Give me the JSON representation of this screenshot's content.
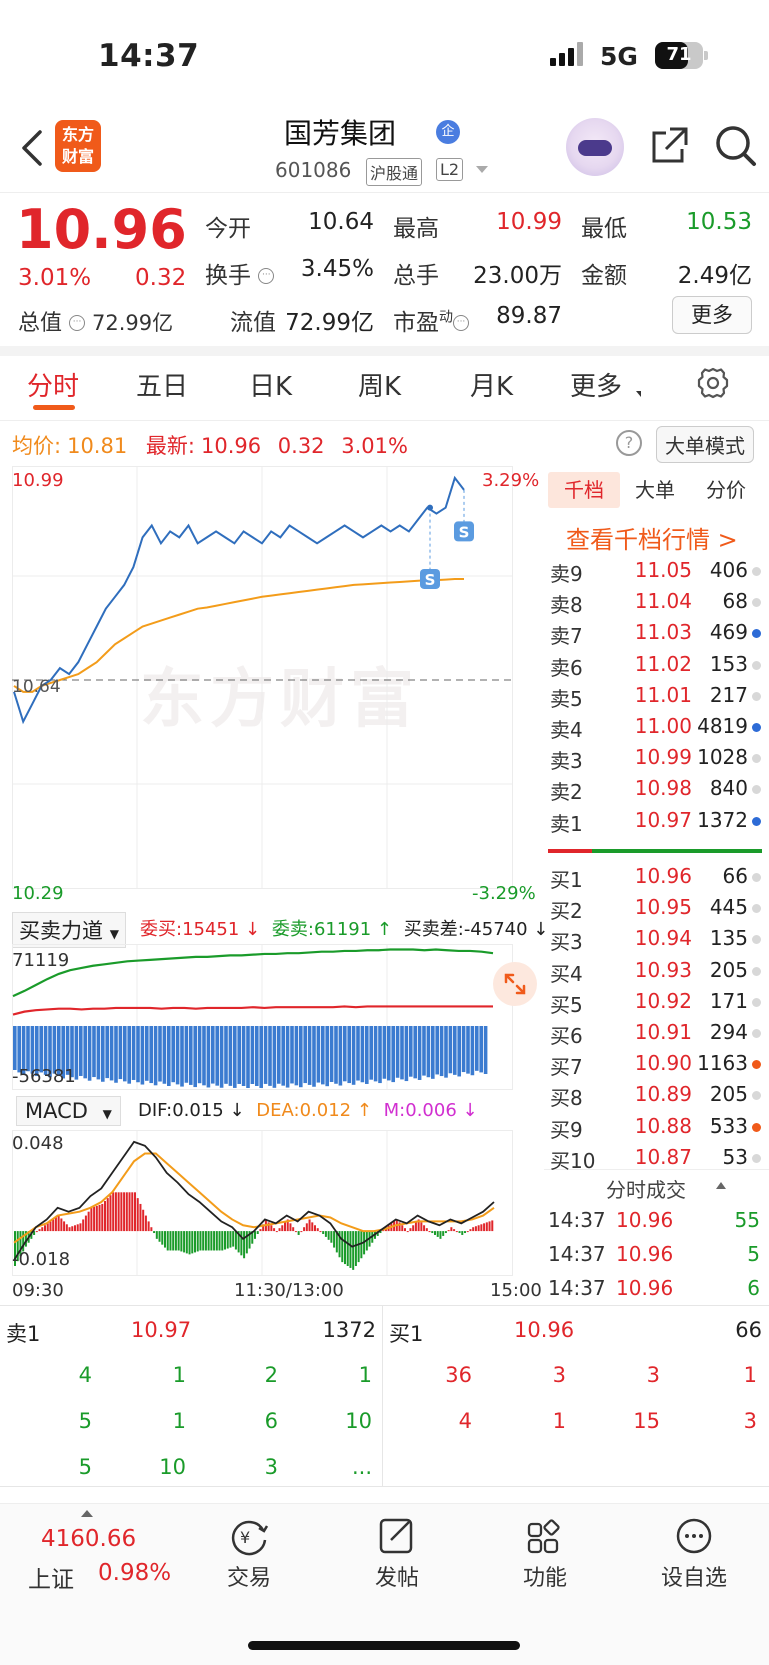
{
  "status_bar": {
    "time": "14:37",
    "network": "5G",
    "battery": "71"
  },
  "header": {
    "logo_text": "东方财富",
    "title": "国芳集团",
    "title_badge": "企",
    "code": "601086",
    "tag_hgt": "沪股通",
    "tag_l2": "L2"
  },
  "quote": {
    "price": "10.96",
    "change_pct": "3.01%",
    "change": "0.32",
    "stats": [
      {
        "label": "今开",
        "value": "10.64",
        "color": "#222222"
      },
      {
        "label": "最高",
        "value": "10.99",
        "color": "#e0262b"
      },
      {
        "label": "最低",
        "value": "10.53",
        "color": "#1a9b2a"
      },
      {
        "label": "换手",
        "value": "3.45%",
        "color": "#222222"
      },
      {
        "label": "总手",
        "value": "23.00万",
        "color": "#222222"
      },
      {
        "label": "金额",
        "value": "2.49亿",
        "color": "#222222"
      },
      {
        "label": "流值",
        "value": "72.99亿",
        "color": "#222222"
      },
      {
        "label": "市盈",
        "value": "89.87",
        "color": "#222222"
      }
    ],
    "total_value_label": "总值",
    "total_value": "72.99亿",
    "pe_sup": "动",
    "more": "更多"
  },
  "tabs": [
    "分时",
    "五日",
    "日K",
    "周K",
    "月K",
    "更多"
  ],
  "info_line": {
    "avg_label": "均价:",
    "avg": "10.81",
    "latest_label": "最新:",
    "latest": "10.96",
    "chg": "0.32",
    "pct": "3.01%",
    "help": "?",
    "bigmode": "大单模式"
  },
  "chart": {
    "high": "10.99",
    "low": "10.29",
    "high_pct": "3.29%",
    "low_pct": "-3.29%",
    "open": "10.64",
    "watermark": "东方财富",
    "marker": "S",
    "ylim": [
      10.29,
      10.99
    ],
    "price_series": [
      10.62,
      10.57,
      10.6,
      10.63,
      10.64,
      10.66,
      10.65,
      10.67,
      10.7,
      10.73,
      10.76,
      10.78,
      10.8,
      10.83,
      10.88,
      10.9,
      10.87,
      10.89,
      10.88,
      10.9,
      10.87,
      10.88,
      10.89,
      10.88,
      10.87,
      10.89,
      10.88,
      10.87,
      10.89,
      10.88,
      10.9,
      10.89,
      10.88,
      10.87,
      10.88,
      10.89,
      10.9,
      10.89,
      10.88,
      10.89,
      10.9,
      10.89,
      10.9,
      10.89,
      10.91,
      10.93,
      10.92,
      10.93,
      10.98,
      10.96
    ],
    "avg_series": [
      10.63,
      10.62,
      10.62,
      10.63,
      10.635,
      10.64,
      10.645,
      10.65,
      10.66,
      10.67,
      10.685,
      10.7,
      10.71,
      10.72,
      10.73,
      10.735,
      10.74,
      10.745,
      10.75,
      10.755,
      10.76,
      10.762,
      10.765,
      10.768,
      10.771,
      10.774,
      10.777,
      10.78,
      10.782,
      10.784,
      10.786,
      10.788,
      10.79,
      10.792,
      10.794,
      10.796,
      10.798,
      10.8,
      10.801,
      10.802,
      10.803,
      10.804,
      10.805,
      10.806,
      10.807,
      10.808,
      10.808,
      10.809,
      10.81,
      10.81
    ]
  },
  "moneyflow": {
    "selector": "买卖力道",
    "wb_label": "委买:15451",
    "ws_label": "委卖:61191",
    "diff_label": "买卖差:-45740",
    "top": "71119",
    "bottom": "-56381",
    "green_series": [
      0.35,
      0.42,
      0.5,
      0.58,
      0.65,
      0.7,
      0.73,
      0.76,
      0.78,
      0.8,
      0.82,
      0.83,
      0.84,
      0.85,
      0.86,
      0.87,
      0.88,
      0.88,
      0.89,
      0.9,
      0.9,
      0.91,
      0.92,
      0.92,
      0.93,
      0.93,
      0.94,
      0.95,
      0.95,
      0.96,
      0.96,
      0.97,
      0.97,
      0.98,
      0.98,
      0.98,
      0.97,
      0.98,
      0.97,
      0.96,
      0.96,
      0.95,
      0.93
    ],
    "red_series": [
      0.1,
      0.14,
      0.16,
      0.17,
      0.18,
      0.18,
      0.17,
      0.18,
      0.18,
      0.19,
      0.19,
      0.19,
      0.19,
      0.18,
      0.19,
      0.19,
      0.18,
      0.19,
      0.19,
      0.19,
      0.19,
      0.2,
      0.19,
      0.2,
      0.2,
      0.2,
      0.2,
      0.2,
      0.2,
      0.21,
      0.2,
      0.21,
      0.21,
      0.21,
      0.21,
      0.21,
      0.21,
      0.21,
      0.21,
      0.21,
      0.21,
      0.21,
      0.21
    ]
  },
  "macd": {
    "selector": "MACD",
    "dif_label": "DIF:0.015",
    "dea_label": "DEA:0.012",
    "m_label": "M:0.006",
    "top": "0.048",
    "bottom": "-0.018",
    "ylim": [
      -0.018,
      0.048
    ],
    "dif": [
      -0.015,
      -0.006,
      0.002,
      0.006,
      0.012,
      0.01,
      0.012,
      0.018,
      0.022,
      0.03,
      0.038,
      0.046,
      0.044,
      0.038,
      0.03,
      0.025,
      0.019,
      0.015,
      0.01,
      0.005,
      0.002,
      -0.004,
      0.0,
      0.006,
      0.004,
      0.008,
      0.005,
      0.01,
      0.008,
      0.004,
      -0.004,
      -0.008,
      -0.006,
      -0.002,
      0.002,
      0.006,
      0.004,
      0.008,
      0.005,
      0.003,
      0.006,
      0.004,
      0.007,
      0.01,
      0.015
    ],
    "dea": [
      -0.006,
      -0.002,
      0.002,
      0.004,
      0.008,
      0.009,
      0.01,
      0.012,
      0.015,
      0.02,
      0.028,
      0.036,
      0.04,
      0.04,
      0.035,
      0.03,
      0.025,
      0.02,
      0.015,
      0.01,
      0.006,
      0.003,
      0.002,
      0.003,
      0.004,
      0.005,
      0.006,
      0.007,
      0.008,
      0.007,
      0.004,
      0.002,
      0.0,
      0.0,
      0.001,
      0.003,
      0.004,
      0.005,
      0.005,
      0.005,
      0.005,
      0.005,
      0.006,
      0.008,
      0.012
    ]
  },
  "time_axis": [
    "09:30",
    "11:30/13:00",
    "15:00"
  ],
  "right_panel": {
    "tabs": [
      "千档",
      "大单",
      "分价"
    ],
    "link": "查看千档行情 >",
    "asks": [
      {
        "name": "卖9",
        "price": "11.05",
        "vol": "406",
        "dot": "#d8d8d8"
      },
      {
        "name": "卖8",
        "price": "11.04",
        "vol": "68",
        "dot": "#d8d8d8"
      },
      {
        "name": "卖7",
        "price": "11.03",
        "vol": "469",
        "dot": "#2d6bd6"
      },
      {
        "name": "卖6",
        "price": "11.02",
        "vol": "153",
        "dot": "#d8d8d8"
      },
      {
        "name": "卖5",
        "price": "11.01",
        "vol": "217",
        "dot": "#d8d8d8"
      },
      {
        "name": "卖4",
        "price": "11.00",
        "vol": "4819",
        "dot": "#2d6bd6"
      },
      {
        "name": "卖3",
        "price": "10.99",
        "vol": "1028",
        "dot": "#d8d8d8"
      },
      {
        "name": "卖2",
        "price": "10.98",
        "vol": "840",
        "dot": "#d8d8d8"
      },
      {
        "name": "卖1",
        "price": "10.97",
        "vol": "1372",
        "dot": "#2d6bd6"
      }
    ],
    "bids": [
      {
        "name": "买1",
        "price": "10.96",
        "vol": "66",
        "dot": "#d8d8d8"
      },
      {
        "name": "买2",
        "price": "10.95",
        "vol": "445",
        "dot": "#d8d8d8"
      },
      {
        "name": "买3",
        "price": "10.94",
        "vol": "135",
        "dot": "#d8d8d8"
      },
      {
        "name": "买4",
        "price": "10.93",
        "vol": "205",
        "dot": "#d8d8d8"
      },
      {
        "name": "买5",
        "price": "10.92",
        "vol": "171",
        "dot": "#d8d8d8"
      },
      {
        "name": "买6",
        "price": "10.91",
        "vol": "294",
        "dot": "#d8d8d8"
      },
      {
        "name": "买7",
        "price": "10.90",
        "vol": "1163",
        "dot": "#f05a1a"
      },
      {
        "name": "买8",
        "price": "10.89",
        "vol": "205",
        "dot": "#d8d8d8"
      },
      {
        "name": "买9",
        "price": "10.88",
        "vol": "533",
        "dot": "#f05a1a"
      },
      {
        "name": "买10",
        "price": "10.87",
        "vol": "53",
        "dot": "#d8d8d8"
      }
    ],
    "ticks_title": "分时成交",
    "ticks": [
      {
        "time": "14:37",
        "price": "10.96",
        "vol": "55"
      },
      {
        "time": "14:37",
        "price": "10.96",
        "vol": "5"
      },
      {
        "time": "14:37",
        "price": "10.96",
        "vol": "6"
      }
    ]
  },
  "queue": {
    "sell_label": "卖1",
    "sell_price": "10.97",
    "sell_vol": "1372",
    "buy_label": "买1",
    "buy_price": "10.96",
    "buy_vol": "66",
    "sell_rows": [
      [
        "4",
        "1",
        "2",
        "1"
      ],
      [
        "5",
        "1",
        "6",
        "10"
      ],
      [
        "5",
        "10",
        "3",
        "..."
      ]
    ],
    "buy_rows": [
      [
        "36",
        "3",
        "3",
        "1"
      ],
      [
        "4",
        "1",
        "15",
        "3"
      ]
    ]
  },
  "bottom_bar": {
    "index_value": "4160.66",
    "index_name": "上证",
    "index_pct": "0.98%",
    "nav": [
      {
        "icon": "trade-icon",
        "label": "交易"
      },
      {
        "icon": "post-icon",
        "label": "发帖"
      },
      {
        "icon": "function-icon",
        "label": "功能"
      },
      {
        "icon": "watchlist-icon",
        "label": "设自选"
      }
    ]
  }
}
